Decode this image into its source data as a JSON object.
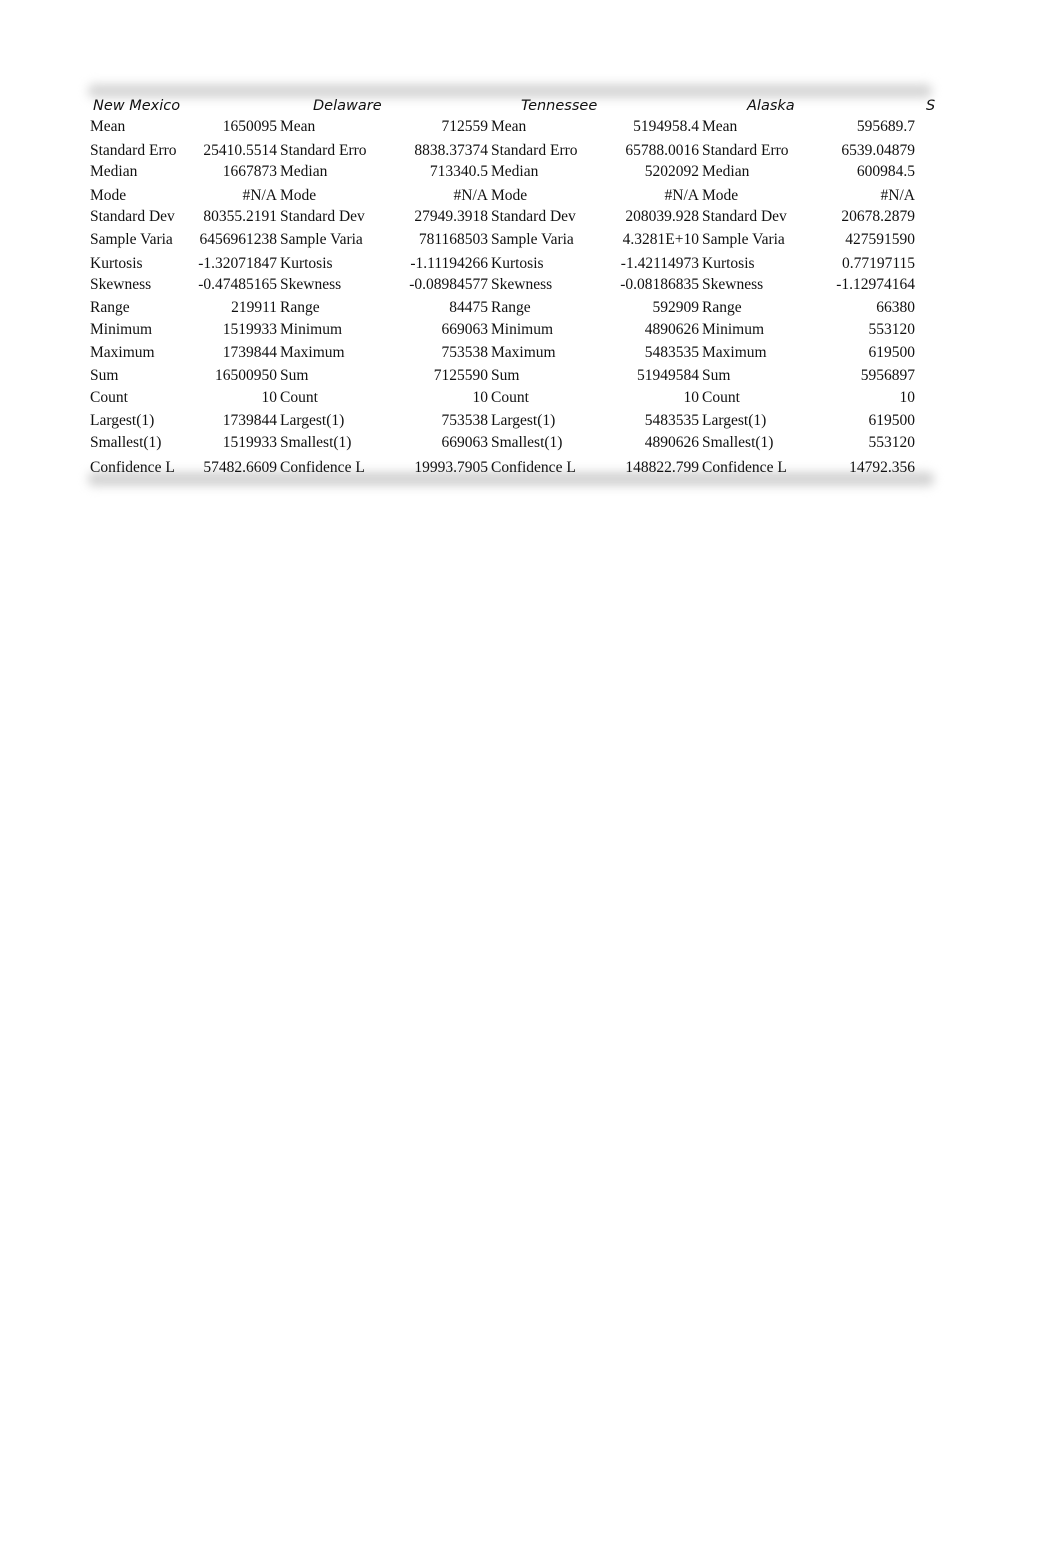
{
  "columns": [
    "New Mexico",
    "Delaware",
    "Tennessee",
    "Alaska",
    "S"
  ],
  "rows": [
    {
      "label": "Mean",
      "values": [
        "1650095",
        "712559",
        "5194958.4",
        "595689.7"
      ]
    },
    {
      "label": "Standard Erro",
      "values": [
        "25410.5514",
        "8838.37374",
        "65788.0016",
        "6539.04879"
      ]
    },
    {
      "label": "Median",
      "values": [
        "1667873",
        "713340.5",
        "5202092",
        "600984.5"
      ]
    },
    {
      "label": "Mode",
      "values": [
        "#N/A",
        "#N/A",
        "#N/A",
        "#N/A"
      ]
    },
    {
      "label": "Standard Dev",
      "values": [
        "80355.2191",
        "27949.3918",
        "208039.928",
        "20678.2879"
      ]
    },
    {
      "label": "Sample Varia",
      "values": [
        "6456961238",
        "781168503",
        "4.3281E+10",
        "427591590"
      ]
    },
    {
      "label": "Kurtosis",
      "values": [
        "-1.32071847",
        "-1.11194266",
        "-1.42114973",
        "0.77197115"
      ]
    },
    {
      "label": "Skewness",
      "values": [
        "-0.47485165",
        "-0.08984577",
        "-0.08186835",
        "-1.12974164"
      ]
    },
    {
      "label": "Range",
      "values": [
        "219911",
        "84475",
        "592909",
        "66380"
      ]
    },
    {
      "label": "Minimum",
      "values": [
        "1519933",
        "669063",
        "4890626",
        "553120"
      ]
    },
    {
      "label": "Maximum",
      "values": [
        "1739844",
        "753538",
        "5483535",
        "619500"
      ]
    },
    {
      "label": "Sum",
      "values": [
        "16500950",
        "7125590",
        "51949584",
        "5956897"
      ]
    },
    {
      "label": "Count",
      "values": [
        "10",
        "10",
        "10",
        "10"
      ]
    },
    {
      "label": "Largest(1)",
      "values": [
        "1739844",
        "753538",
        "5483535",
        "619500"
      ]
    },
    {
      "label": "Smallest(1)",
      "values": [
        "1519933",
        "669063",
        "4890626",
        "553120"
      ]
    },
    {
      "label": "Confidence L",
      "values": [
        "57482.6609",
        "19993.7905",
        "148822.799",
        "14792.356"
      ]
    }
  ]
}
